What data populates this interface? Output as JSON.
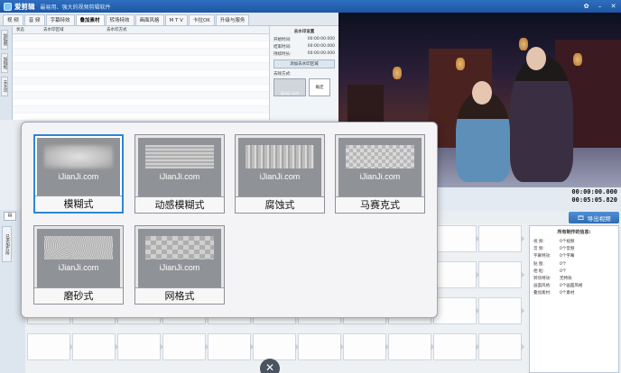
{
  "app": {
    "title": "爱剪辑",
    "subtitle": "最易用、强大的视频剪辑软件"
  },
  "tabs": [
    "视  频",
    "音  频",
    "字幕特效",
    "叠加素材",
    "转场特效",
    "画面风格",
    "M T V",
    "卡拉OK",
    "升级与服务"
  ],
  "sidetabs": [
    "加贴图",
    "加相框",
    "去水印"
  ],
  "list": {
    "headers": [
      "状态",
      "去水印区域",
      "去水印方式"
    ]
  },
  "rightpanel": {
    "title": "去水印设置",
    "lines": [
      {
        "k": "开始时间:",
        "v": "00:00:00.000"
      },
      {
        "k": "结束时间:",
        "v": "00:00:00.000"
      },
      {
        "k": "持续时长:",
        "v": "00:00:00.000"
      }
    ],
    "add_label": "添加去水印区域",
    "method_label": "去除方式:",
    "confirm": "确定"
  },
  "time": {
    "current": "00:00:00.000",
    "total": "00:05:05.820"
  },
  "export_label": "导出视频",
  "lower_tab": "已添加片段",
  "info": {
    "title": "所有制作的信息:",
    "rows": [
      {
        "k": "视  频:",
        "v": "0个视频"
      },
      {
        "k": "音  频:",
        "v": "0个音频"
      },
      {
        "k": "字幕特效:",
        "v": "0个字幕"
      },
      {
        "k": "贴  图:",
        "v": "0个"
      },
      {
        "k": "相  框:",
        "v": "0个"
      },
      {
        "k": "转场特效:",
        "v": "无特效"
      },
      {
        "k": "画面风格:",
        "v": "0个画面风格"
      },
      {
        "k": "叠加素材:",
        "v": "0个素材"
      }
    ]
  },
  "effects": [
    {
      "label": "模糊式",
      "watermark": "iJianJi.com",
      "fx": "blur",
      "selected": true
    },
    {
      "label": "动感模糊式",
      "watermark": "iJianJi.com",
      "fx": "motion",
      "selected": false
    },
    {
      "label": "腐蚀式",
      "watermark": "iJianJi.com",
      "fx": "erode",
      "selected": false
    },
    {
      "label": "马赛克式",
      "watermark": "iJianJi.com",
      "fx": "mosaic",
      "selected": false
    },
    {
      "label": "磨砂式",
      "watermark": "iJianJi.com",
      "fx": "frost",
      "selected": false
    },
    {
      "label": "网格式",
      "watermark": "iJianJi.com",
      "fx": "grid",
      "selected": false
    }
  ],
  "icons": {
    "collapse": "collapse-icon",
    "export": "film-icon"
  },
  "colors": {
    "accent": "#2b87d8",
    "titlebar": "#1d57a3"
  }
}
